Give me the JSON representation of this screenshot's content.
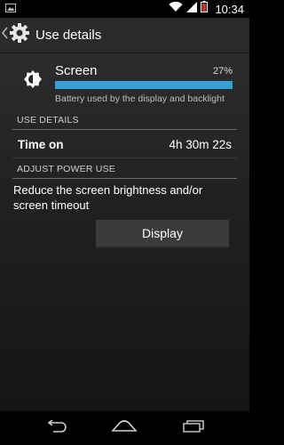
{
  "status_bar": {
    "time": "10:34",
    "icons": [
      "picture-notification-icon",
      "wifi-icon",
      "signal-icon",
      "battery-icon"
    ]
  },
  "action_bar": {
    "title": "Use details",
    "icon": "settings-gear-icon"
  },
  "app": {
    "name": "Screen",
    "percent_label": "27%",
    "percent_value": 100,
    "description": "Battery used by the display and backlight",
    "icon": "brightness-icon"
  },
  "sections": {
    "use_details": "USE DETAILS",
    "adjust_power_use": "ADJUST POWER USE"
  },
  "time_on": {
    "label": "Time on",
    "value": "4h 30m 22s"
  },
  "adjust": {
    "text": "Reduce the screen brightness and/or screen timeout",
    "button_label": "Display"
  },
  "nav_bar": {
    "icons": [
      "back-icon",
      "home-icon",
      "recent-apps-icon"
    ]
  },
  "colors": {
    "accent": "#35a0d6",
    "action_bar": "#2a2b2d",
    "button": "#3a3b3d"
  }
}
